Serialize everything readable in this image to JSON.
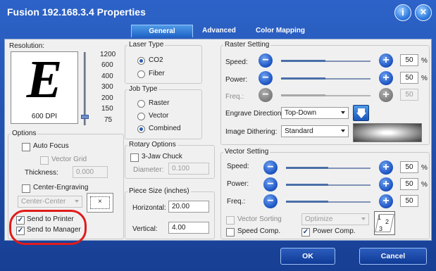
{
  "window": {
    "title": "Fusion 192.168.3.4 Properties"
  },
  "titlebar": {
    "help_glyph": "i",
    "close_glyph": "✕"
  },
  "tabs": [
    {
      "label": "General"
    },
    {
      "label": "Advanced"
    },
    {
      "label": "Color Mapping"
    }
  ],
  "resolution": {
    "label": "Resolution:",
    "preview_letter": "E",
    "dpi_label": "600 DPI",
    "scale": [
      "1200",
      "600",
      "400",
      "300",
      "200",
      "150",
      "75"
    ]
  },
  "options": {
    "label": "Options",
    "auto_focus": "Auto Focus",
    "vector_grid": "Vector Grid",
    "thickness_label": "Thickness:",
    "thickness_value": "0.000",
    "center_engraving": "Center-Engraving",
    "center_select": "Center-Center",
    "send_to_printer": "Send to Printer",
    "send_to_manager": "Send to Manager",
    "send_to_printer_checked": true,
    "send_to_manager_checked": true
  },
  "laser_type": {
    "label": "Laser Type",
    "co2": "CO2",
    "fiber": "Fiber",
    "selected": "CO2"
  },
  "job_type": {
    "label": "Job Type",
    "raster": "Raster",
    "vector": "Vector",
    "combined": "Combined",
    "selected": "Combined"
  },
  "rotary": {
    "label": "Rotary Options",
    "chuck": "3-Jaw Chuck",
    "diameter_label": "Diameter:",
    "diameter_value": "0.100"
  },
  "piece_size": {
    "label": "Piece Size (inches)",
    "horizontal_label": "Horizontal:",
    "horizontal_value": "20.00",
    "vertical_label": "Vertical:",
    "vertical_value": "4.00"
  },
  "raster": {
    "label": "Raster Setting",
    "speed_label": "Speed:",
    "speed_value": "50",
    "speed_unit": "%",
    "power_label": "Power:",
    "power_value": "50",
    "power_unit": "%",
    "freq_label": "Freq.:",
    "freq_value": "50",
    "direction_label": "Engrave Direction:",
    "direction_value": "Top-Down",
    "dithering_label": "Image Dithering:",
    "dithering_value": "Standard"
  },
  "vector": {
    "label": "Vector Setting",
    "speed_label": "Speed:",
    "speed_value": "50",
    "speed_unit": "%",
    "power_label": "Power:",
    "power_value": "50",
    "power_unit": "%",
    "freq_label": "Freq.:",
    "freq_value": "50",
    "sorting_label": "Vector Sorting",
    "sorting_value": "Optimize",
    "speed_comp": "Speed Comp.",
    "power_comp": "Power Comp.",
    "power_comp_checked": true
  },
  "buttons": {
    "ok": "OK",
    "cancel": "Cancel"
  },
  "colors": {
    "titlebar": "#2d63c8",
    "highlight": "#e01b1b",
    "accent": "#1f56c4"
  }
}
